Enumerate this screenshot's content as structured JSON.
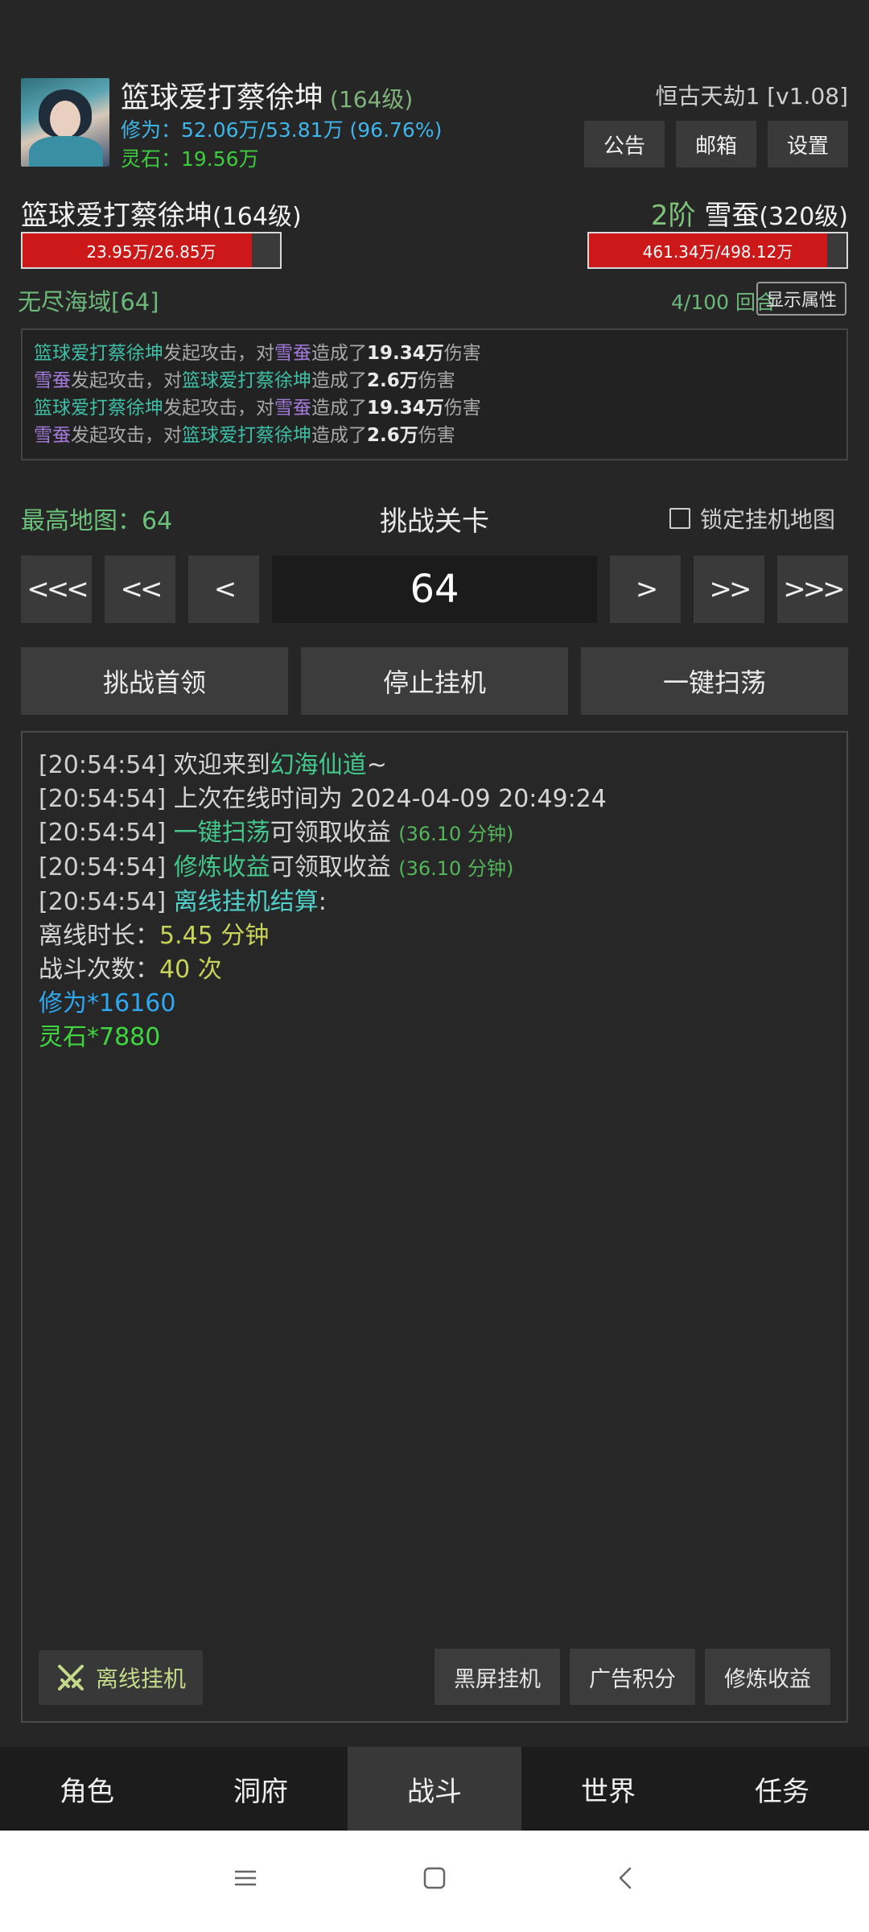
{
  "player": {
    "name": "篮球爱打蔡徐坤",
    "level": "(164级)",
    "cultivation": "修为：52.06万/53.81万 (96.76%)",
    "spirit_stone": "灵石：19.56万"
  },
  "header": {
    "game_title": "恒古天劫1 [v1.08]",
    "buttons": [
      "公告",
      "邮箱",
      "设置"
    ]
  },
  "battle": {
    "player_name": "篮球爱打蔡徐坤",
    "player_level": "(164级)",
    "player_hp_text": "23.95万/26.85万",
    "player_hp_ratio": 0.892,
    "enemy_rank": "2阶",
    "enemy_name": "雪蚕",
    "enemy_level": "(320级)",
    "enemy_hp_text": "461.34万/498.12万",
    "enemy_hp_ratio": 0.926,
    "region": "无尽海域[64]",
    "rounds": "4/100 回合",
    "show_attr_label": "显示属性",
    "log": [
      {
        "attacker": "篮球爱打蔡徐坤",
        "mid1": "发起攻击，对",
        "target": "雪蚕",
        "mid2": "造成了",
        "damage": "19.34万",
        "end": "伤害"
      },
      {
        "attacker": "雪蚕",
        "mid1": "发起攻击，对",
        "target": "篮球爱打蔡徐坤",
        "mid2": "造成了",
        "damage": "2.6万",
        "end": "伤害"
      },
      {
        "attacker": "篮球爱打蔡徐坤",
        "mid1": "发起攻击，对",
        "target": "雪蚕",
        "mid2": "造成了",
        "damage": "19.34万",
        "end": "伤害"
      },
      {
        "attacker": "雪蚕",
        "mid1": "发起攻击，对",
        "target": "篮球爱打蔡徐坤",
        "mid2": "造成了",
        "damage": "2.6万",
        "end": "伤害"
      }
    ]
  },
  "map": {
    "max_map": "最高地图：64",
    "challenge_title": "挑战关卡",
    "lock_label": "锁定挂机地图",
    "stage": "64",
    "nav": [
      "<<<",
      "<<",
      "<",
      ">",
      ">>",
      ">>>"
    ]
  },
  "actions": [
    "挑战首领",
    "停止挂机",
    "一键扫荡"
  ],
  "main_log": {
    "lines": [
      {
        "ts": "[20:54:54]",
        "a": " 欢迎来到",
        "b": "幻海仙道",
        "c": "~"
      },
      {
        "ts": "[20:54:54]",
        "a": " 上次在线时间为 2024-04-09 20:49:24"
      },
      {
        "ts": "[20:54:54]",
        "b": " 一键扫荡",
        "a": "可领取收益 ",
        "s": "(36.10 分钟)"
      },
      {
        "ts": "[20:54:54]",
        "b": " 修炼收益",
        "a": "可领取收益 ",
        "s": "(36.10 分钟)"
      },
      {
        "ts": "[20:54:54]",
        "b": " 离线挂机结算",
        "a": ":"
      }
    ],
    "offline_duration_label": "离线时长：",
    "offline_duration": "5.45 分钟",
    "battle_count_label": "战斗次数：",
    "battle_count": "40 次",
    "xp_gain": "修为*16160",
    "stone_gain": "灵石*7880"
  },
  "bottom_buttons": {
    "offline": "离线挂机",
    "others": [
      "黑屏挂机",
      "广告积分",
      "修炼收益"
    ]
  },
  "tabs": [
    "角色",
    "洞府",
    "战斗",
    "世界",
    "任务"
  ],
  "active_tab": "战斗"
}
